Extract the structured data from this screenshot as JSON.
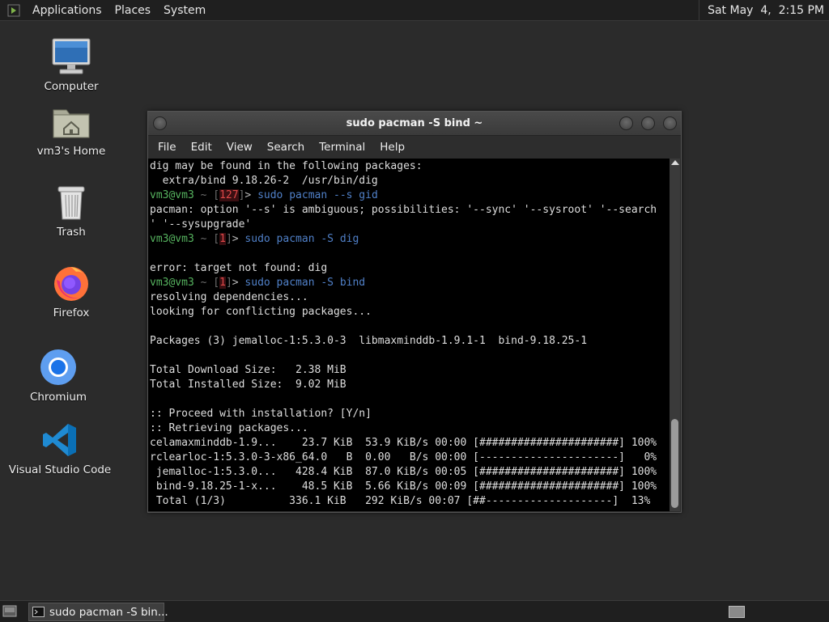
{
  "top_panel": {
    "menus": [
      "Applications",
      "Places",
      "System"
    ],
    "clock": "Sat May  4,  2:15 PM"
  },
  "desktop": {
    "icons": [
      {
        "label": "Computer",
        "icon": "computer-icon"
      },
      {
        "label": "vm3's Home",
        "icon": "home-folder-icon"
      },
      {
        "label": "Trash",
        "icon": "trash-icon"
      },
      {
        "label": "Firefox",
        "icon": "firefox-icon"
      },
      {
        "label": "Chromium",
        "icon": "chromium-icon"
      },
      {
        "label": "Visual Studio Code",
        "icon": "vscode-icon"
      }
    ]
  },
  "terminal": {
    "title": "sudo pacman -S bind ~",
    "menu": [
      "File",
      "Edit",
      "View",
      "Search",
      "Terminal",
      "Help"
    ],
    "prompt": {
      "user": "vm3@vm3",
      "sep": "~",
      "arrow": ">"
    },
    "lines": [
      {
        "type": "out",
        "text": "dig may be found in the following packages:"
      },
      {
        "type": "out",
        "text": "  extra/bind 9.18.26-2  /usr/bin/dig"
      },
      {
        "type": "prompt",
        "code": "127",
        "cmd": "sudo pacman --s gid"
      },
      {
        "type": "out",
        "text": "pacman: option '--s' is ambiguous; possibilities: '--sync' '--sysroot' '--search"
      },
      {
        "type": "out",
        "text": "' '--sysupgrade'"
      },
      {
        "type": "prompt",
        "code": "1",
        "cmd": "sudo pacman -S dig"
      },
      {
        "type": "out",
        "text": ""
      },
      {
        "type": "out",
        "text": "error: target not found: dig"
      },
      {
        "type": "prompt",
        "code": "1",
        "cmd": "sudo pacman -S bind"
      },
      {
        "type": "out",
        "text": "resolving dependencies..."
      },
      {
        "type": "out",
        "text": "looking for conflicting packages..."
      },
      {
        "type": "out",
        "text": ""
      },
      {
        "type": "out",
        "text": "Packages (3) jemalloc-1:5.3.0-3  libmaxminddb-1.9.1-1  bind-9.18.25-1"
      },
      {
        "type": "out",
        "text": ""
      },
      {
        "type": "out",
        "text": "Total Download Size:   2.38 MiB"
      },
      {
        "type": "out",
        "text": "Total Installed Size:  9.02 MiB"
      },
      {
        "type": "out",
        "text": ""
      },
      {
        "type": "out",
        "text": ":: Proceed with installation? [Y/n]"
      },
      {
        "type": "out",
        "text": ":: Retrieving packages..."
      },
      {
        "type": "out",
        "text": "celamaxminddb-1.9...    23.7 KiB  53.9 KiB/s 00:00 [######################] 100%"
      },
      {
        "type": "out",
        "text": "rclearloc-1:5.3.0-3-x86_64.0   B  0.00   B/s 00:00 [----------------------]   0%"
      },
      {
        "type": "out",
        "text": " jemalloc-1:5.3.0...   428.4 KiB  87.0 KiB/s 00:05 [######################] 100%"
      },
      {
        "type": "out",
        "text": " bind-9.18.25-1-x...    48.5 KiB  5.66 KiB/s 00:09 [######################] 100%"
      },
      {
        "type": "out",
        "text": " Total (1/3)          336.1 KiB   292 KiB/s 00:07 [##--------------------]  13%"
      }
    ]
  },
  "taskbar": {
    "task_label": "sudo pacman -S bin..."
  }
}
